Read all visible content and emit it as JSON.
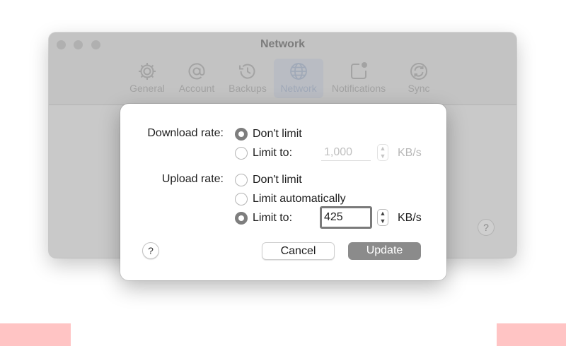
{
  "window": {
    "title": "Network",
    "toolbar": [
      {
        "label": "General",
        "icon": "gear-icon",
        "selected": false
      },
      {
        "label": "Account",
        "icon": "at-sign-icon",
        "selected": false
      },
      {
        "label": "Backups",
        "icon": "history-icon",
        "selected": false
      },
      {
        "label": "Network",
        "icon": "globe-icon",
        "selected": true
      },
      {
        "label": "Notifications",
        "icon": "notification-badge-icon",
        "selected": false
      },
      {
        "label": "Sync",
        "icon": "sync-icon",
        "selected": false
      }
    ],
    "help_label": "?"
  },
  "dialog": {
    "download": {
      "label": "Download rate:",
      "option_no_limit": "Don't limit",
      "option_limit": "Limit to:",
      "selected": "no_limit",
      "value": "1,000",
      "unit": "KB/s"
    },
    "upload": {
      "label": "Upload rate:",
      "option_no_limit": "Don't limit",
      "option_auto": "Limit automatically",
      "option_limit": "Limit to:",
      "selected": "limit",
      "value": "425",
      "unit": "KB/s"
    },
    "help_label": "?",
    "cancel_label": "Cancel",
    "update_label": "Update"
  },
  "colors": {
    "accent_disabled": "#8b8b8b",
    "radio_selected": "#7e7e7e",
    "highlight_pink": "#ffc4c4"
  }
}
